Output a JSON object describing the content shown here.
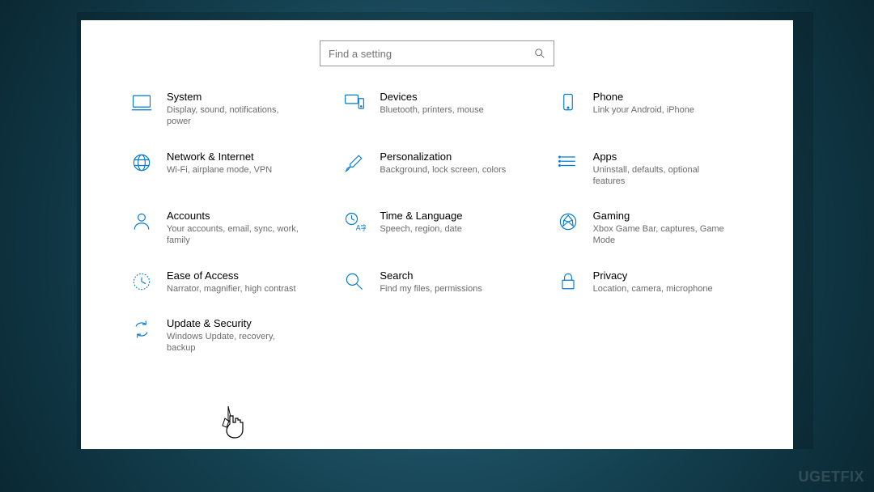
{
  "search": {
    "placeholder": "Find a setting"
  },
  "categories": [
    {
      "title": "System",
      "desc": "Display, sound, notifications, power"
    },
    {
      "title": "Devices",
      "desc": "Bluetooth, printers, mouse"
    },
    {
      "title": "Phone",
      "desc": "Link your Android, iPhone"
    },
    {
      "title": "Network & Internet",
      "desc": "Wi-Fi, airplane mode, VPN"
    },
    {
      "title": "Personalization",
      "desc": "Background, lock screen, colors"
    },
    {
      "title": "Apps",
      "desc": "Uninstall, defaults, optional features"
    },
    {
      "title": "Accounts",
      "desc": "Your accounts, email, sync, work, family"
    },
    {
      "title": "Time & Language",
      "desc": "Speech, region, date"
    },
    {
      "title": "Gaming",
      "desc": "Xbox Game Bar, captures, Game Mode"
    },
    {
      "title": "Ease of Access",
      "desc": "Narrator, magnifier, high contrast"
    },
    {
      "title": "Search",
      "desc": "Find my files, permissions"
    },
    {
      "title": "Privacy",
      "desc": "Location, camera, microphone"
    },
    {
      "title": "Update & Security",
      "desc": "Windows Update, recovery, backup"
    }
  ],
  "watermark": "UGETFIX"
}
